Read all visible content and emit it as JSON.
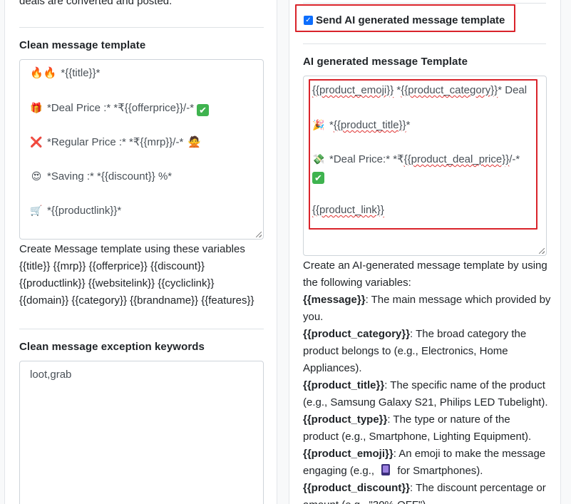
{
  "left": {
    "clipped_text": "deals are converted and posted.",
    "clean_template": {
      "title": "Clean message template",
      "lines": [
        {
          "emoji": "🔥🔥",
          "text": "*{{title}}*"
        },
        {
          "emoji": "🎁",
          "text": "*Deal Price :* *₹{{offerprice}}/-*",
          "trail": "✔"
        },
        {
          "emoji": "❌",
          "text": "*Regular Price :* *₹{{mrp}}/-*",
          "trail_emoji": "🙅"
        },
        {
          "emoji": "😍",
          "text": "*Saving :* *{{discount}} %*"
        },
        {
          "emoji": "🛒",
          "text": "*{{productlink}}*"
        }
      ],
      "help": [
        "Create Message template using these variables",
        "{{title}} {{mrp}} {{offerprice}} {{discount}}",
        "{{productlink}} {{websitelink}} {{cycliclink}}",
        "{{domain}} {{category}} {{brandname}} {{features}}"
      ]
    },
    "exception": {
      "title": "Clean message exception keywords",
      "value": "loot,grab"
    }
  },
  "right": {
    "checkbox_label": "Send AI generated message template",
    "ai_template": {
      "title": "AI generated message Template",
      "line1": {
        "v1": "{{product_emoji}}",
        "mid": " *",
        "v2": "{{product_category}}",
        "tail": "* Deal"
      },
      "line2": {
        "emoji": "🎉",
        "pre": "*",
        "v": "{{product_title}}",
        "post": "*"
      },
      "line3": {
        "emoji": "💸",
        "pre": "*Deal Price:* *₹",
        "v": "{{product_deal_price}}",
        "post": "/-*"
      },
      "line3_check": "✔",
      "line4": "{{product_link}}"
    },
    "help": {
      "intro_1": "Create an AI-generated message template by using",
      "intro_2": "the following variables:",
      "vars": [
        {
          "name": "{{message}}",
          "desc_1": ": The main message which provided by",
          "desc_2": "you."
        },
        {
          "name": "{{product_category}}",
          "desc_1": ": The broad category the",
          "desc_2": "product belongs to (e.g., Electronics, Home",
          "desc_3": "Appliances)."
        },
        {
          "name": "{{product_title}}",
          "desc_1": ": The specific name of the product",
          "desc_2": "(e.g., Samsung Galaxy S21, Philips LED Tubelight)."
        },
        {
          "name": "{{product_type}}",
          "desc_1": ": The type or nature of the",
          "desc_2": "product (e.g., Smartphone, Lighting Equipment)."
        },
        {
          "name": "{{product_emoji}}",
          "desc_1": ": An emoji to make the message",
          "desc_2a": "engaging (e.g., ",
          "desc_2b": " for Smartphones)."
        },
        {
          "name": "{{product_discount}}",
          "desc_1": ": The discount percentage or",
          "desc_2": "amount (e.g., \"30% OFF\")"
        }
      ]
    }
  },
  "colors": {
    "highlight_red": "#d9232a",
    "checkbox_blue": "#0d6efd",
    "spell_red": "#e03131"
  }
}
